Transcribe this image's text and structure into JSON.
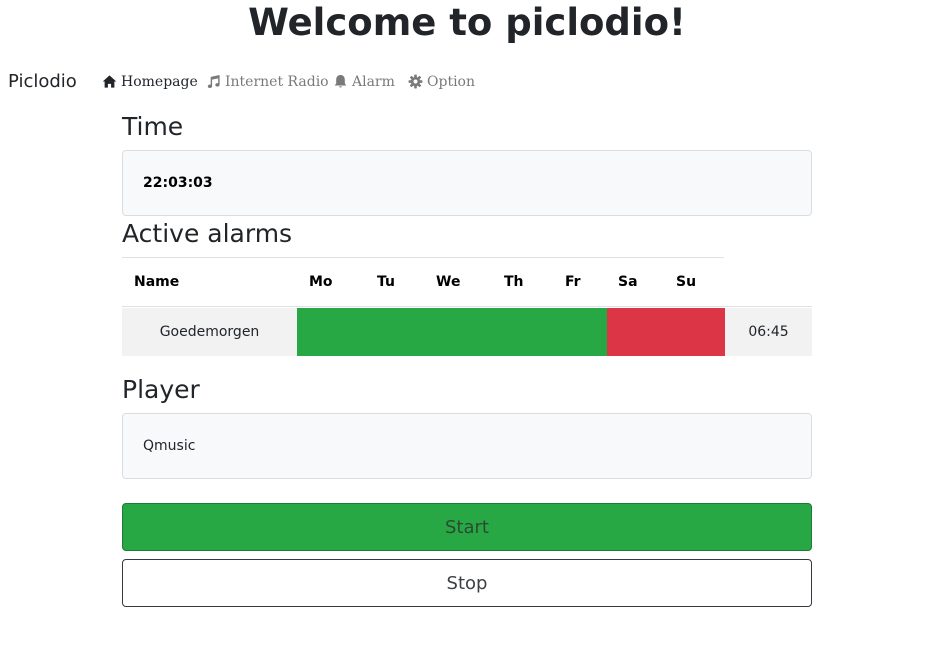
{
  "page": {
    "heading": "Welcome to piclodio!"
  },
  "navbar": {
    "brand": "Piclodio",
    "items": [
      {
        "label": "Homepage",
        "icon": "home-icon",
        "active": true
      },
      {
        "label": "Internet Radio",
        "icon": "music-icon",
        "active": false
      },
      {
        "label": "Alarm",
        "icon": "bell-icon",
        "active": false
      },
      {
        "label": "Option",
        "icon": "gear-icon",
        "active": false
      }
    ]
  },
  "time_section": {
    "title": "Time",
    "value": "22:03:03"
  },
  "alarms_section": {
    "title": "Active alarms",
    "columns": [
      "Name",
      "Mo",
      "Tu",
      "We",
      "Th",
      "Fr",
      "Sa",
      "Su"
    ],
    "rows": [
      {
        "name": "Goedemorgen",
        "days": {
          "Mo": true,
          "Tu": true,
          "We": true,
          "Th": true,
          "Fr": true,
          "Sa": false,
          "Su": false
        },
        "time": "06:45"
      }
    ]
  },
  "player_section": {
    "title": "Player",
    "station": "Qmusic"
  },
  "controls": {
    "start_label": "Start",
    "stop_label": "Stop"
  },
  "colors": {
    "active_day": "#28a745",
    "inactive_day": "#dc3545",
    "start_button": "#28a745"
  }
}
